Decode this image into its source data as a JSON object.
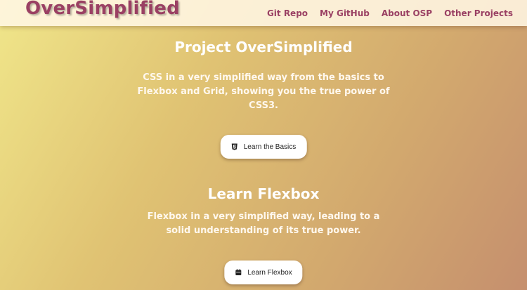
{
  "header": {
    "brand": "OverSimplified",
    "nav": [
      {
        "label": "Git Repo"
      },
      {
        "label": "My GitHub"
      },
      {
        "label": "About OSP"
      },
      {
        "label": "Other Projects"
      }
    ]
  },
  "sections": [
    {
      "title": "Project OverSimplified",
      "description": "CSS in a very simplified way from the basics to Flexbox and Grid, showing you the true power of CSS3.",
      "button": {
        "label": "Learn the Basics",
        "icon": "css3-icon"
      }
    },
    {
      "title": "Learn Flexbox",
      "description": "Flexbox in a very simplified way, leading to a solid understanding of its true power.",
      "button": {
        "label": "Learn Flexbox",
        "icon": "box-icon"
      }
    }
  ],
  "colors": {
    "brand": "#9a4063",
    "gradient_start": "#f0e68a",
    "gradient_end": "#c58f6e"
  }
}
